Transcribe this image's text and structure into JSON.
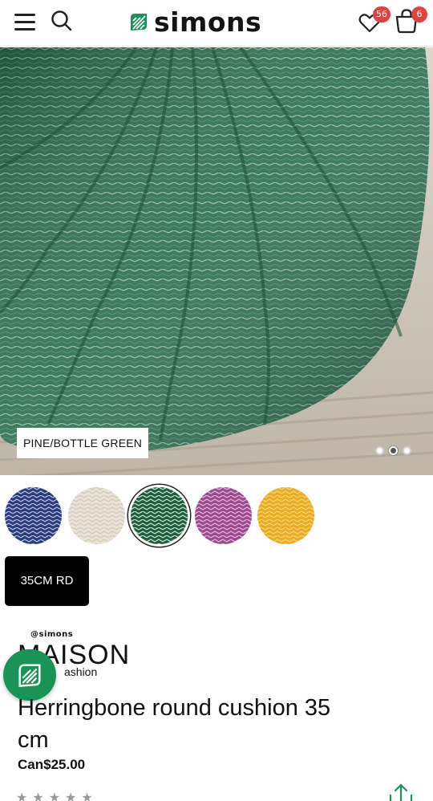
{
  "header": {
    "logo_text": "simons",
    "favorites_count": "56",
    "cart_count": "6",
    "brand_color": "#1a9356"
  },
  "product": {
    "image_color_label": "PINE/BOTTLE GREEN",
    "carousel": {
      "total": 3,
      "active_index": 1
    },
    "swatches": [
      {
        "name": "navy-swatch",
        "color": "#2b3b7a",
        "selected": false
      },
      {
        "name": "cream-swatch",
        "color": "#e9e3d7",
        "selected": false
      },
      {
        "name": "green-swatch",
        "color": "#1f5d3e",
        "selected": true
      },
      {
        "name": "purple-swatch",
        "color": "#9c4a8e",
        "selected": false
      },
      {
        "name": "yellow-swatch",
        "color": "#e9ac22",
        "selected": false
      }
    ],
    "size_label": "35CM RD",
    "brand": {
      "top": "@simons",
      "main": "MAISON",
      "sub": "ashion"
    },
    "title": "Herringbone round cushion 35 cm",
    "price": "Can$25.00",
    "rating_glyphs": "★★★★★"
  }
}
